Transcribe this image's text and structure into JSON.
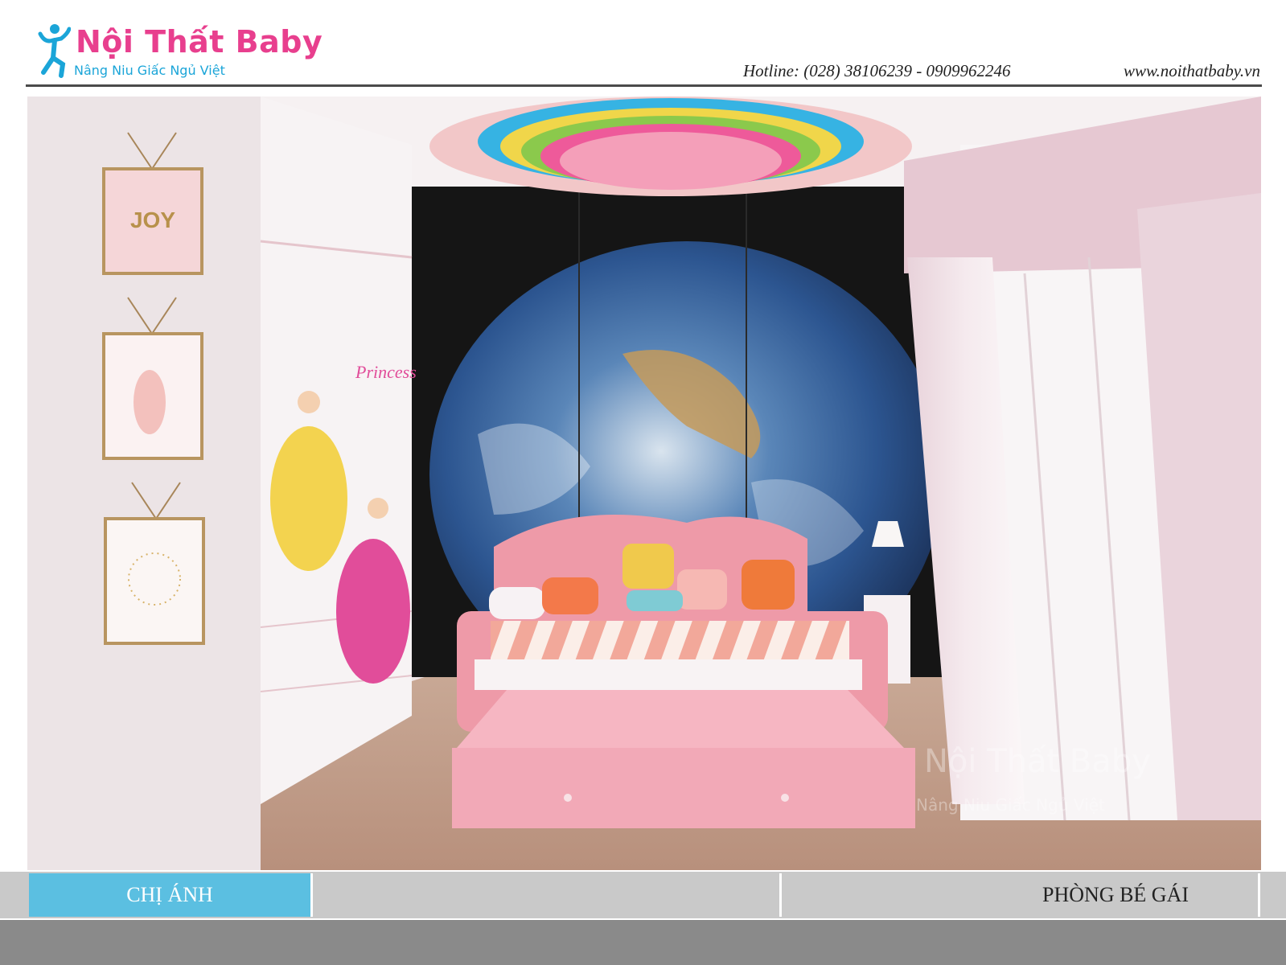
{
  "header": {
    "brand_title": "Nội Thất Baby",
    "brand_tagline": "Nâng Niu Giấc Ngủ Việt",
    "hotline": "Hotline: (028) 38106239  - 0909962246",
    "website": "www.noithatbaby.vn"
  },
  "photo": {
    "frame_top_label": "JOY",
    "wardrobe_decal_text": "Princess",
    "watermark_title": "Nội Thất Baby",
    "watermark_tagline": "Nâng Niu Giấc Ngủ Việt"
  },
  "footer": {
    "client_label": "CHỊ ÁNH",
    "room_label": "PHÒNG BÉ GÁI"
  },
  "colors": {
    "brand_pink": "#e83f8e",
    "brand_blue": "#1ba5d8",
    "tab_blue": "#5bbfe1",
    "strip_gray": "#c9c9c9",
    "bottom_gray": "#8a8a8a"
  }
}
